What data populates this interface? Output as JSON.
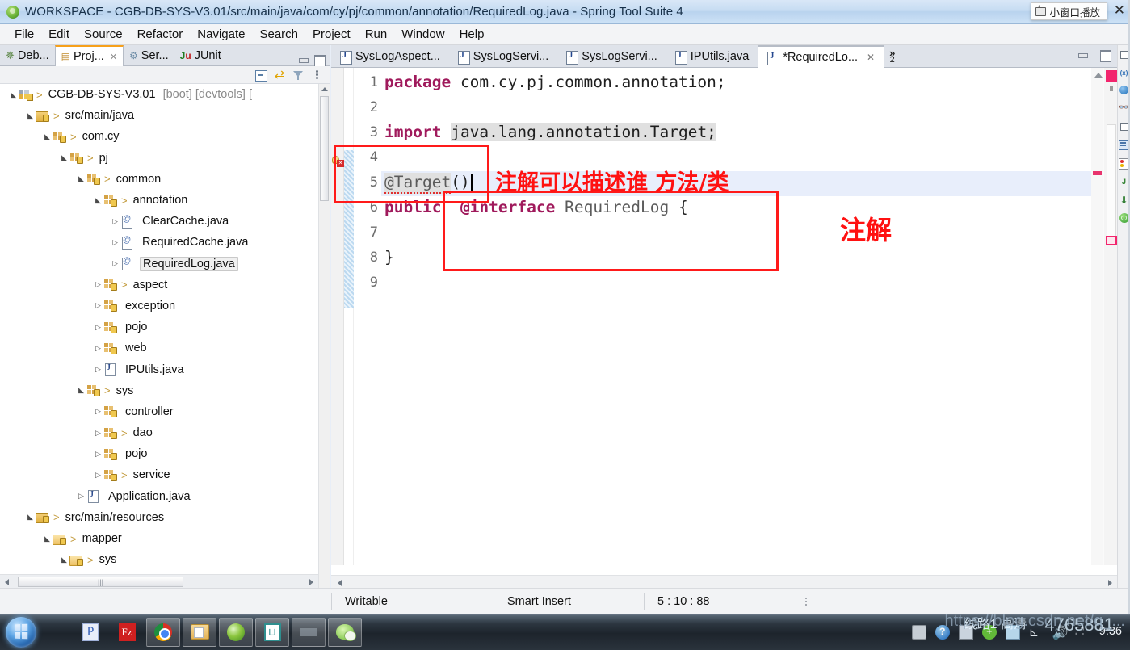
{
  "window": {
    "title": "WORKSPACE - CGB-DB-SYS-V3.01/src/main/java/com/cy/pj/common/annotation/RequiredLog.java - Spring Tool Suite 4",
    "app_icon": "sts-leaf-icon",
    "float_button_label": "小窗口播放",
    "close_label": "✕"
  },
  "menubar": {
    "items": [
      "File",
      "Edit",
      "Source",
      "Refactor",
      "Navigate",
      "Search",
      "Project",
      "Run",
      "Window",
      "Help"
    ]
  },
  "left_panel": {
    "tabs": [
      {
        "label": "Deb...",
        "icon": "debug-icon",
        "active": false,
        "closable": false
      },
      {
        "label": "Proj...",
        "icon": "package-explorer-icon",
        "active": true,
        "closable": true
      },
      {
        "label": "Ser...",
        "icon": "servers-icon",
        "active": false,
        "closable": false
      },
      {
        "label": "JUnit",
        "icon": "junit-icon",
        "active": false,
        "closable": false
      }
    ],
    "window_buttons": [
      "minimize-icon",
      "maximize-icon"
    ],
    "toolbar": [
      "collapse-all-icon",
      "link-with-editor-icon",
      "filter-icon",
      "view-menu-icon"
    ],
    "tree": [
      {
        "depth": 0,
        "expander": "expanded",
        "icon": "project-icon",
        "label": "CGB-DB-SYS-V3.01",
        "suffix": "[boot] [devtools] [",
        "arrow": true,
        "selected": false
      },
      {
        "depth": 1,
        "expander": "expanded",
        "icon": "source-folder-icon",
        "label": "src/main/java",
        "suffix": "",
        "arrow": true,
        "selected": false
      },
      {
        "depth": 2,
        "expander": "expanded",
        "icon": "package-icon",
        "label": "com.cy",
        "suffix": "",
        "arrow": true,
        "selected": false
      },
      {
        "depth": 3,
        "expander": "expanded",
        "icon": "package-icon",
        "label": "pj",
        "suffix": "",
        "arrow": true,
        "selected": false
      },
      {
        "depth": 4,
        "expander": "expanded",
        "icon": "package-icon",
        "label": "common",
        "suffix": "",
        "arrow": true,
        "selected": false
      },
      {
        "depth": 5,
        "expander": "expanded",
        "icon": "package-icon",
        "label": "annotation",
        "suffix": "",
        "arrow": true,
        "selected": false
      },
      {
        "depth": 6,
        "expander": "collapsed",
        "icon": "annotation-file-icon",
        "label": "ClearCache.java",
        "suffix": "",
        "arrow": false,
        "selected": false
      },
      {
        "depth": 6,
        "expander": "collapsed",
        "icon": "annotation-file-icon",
        "label": "RequiredCache.java",
        "suffix": "",
        "arrow": false,
        "selected": false
      },
      {
        "depth": 6,
        "expander": "collapsed",
        "icon": "annotation-file-icon",
        "label": "RequiredLog.java",
        "suffix": "",
        "arrow": false,
        "selected": true
      },
      {
        "depth": 5,
        "expander": "collapsed",
        "icon": "package-icon",
        "label": "aspect",
        "suffix": "",
        "arrow": true,
        "selected": false
      },
      {
        "depth": 5,
        "expander": "collapsed",
        "icon": "package-icon",
        "label": "exception",
        "suffix": "",
        "arrow": false,
        "selected": false
      },
      {
        "depth": 5,
        "expander": "collapsed",
        "icon": "package-icon",
        "label": "pojo",
        "suffix": "",
        "arrow": false,
        "selected": false
      },
      {
        "depth": 5,
        "expander": "collapsed",
        "icon": "package-icon",
        "label": "web",
        "suffix": "",
        "arrow": false,
        "selected": false
      },
      {
        "depth": 5,
        "expander": "collapsed",
        "icon": "java-file-icon",
        "label": "IPUtils.java",
        "suffix": "",
        "arrow": false,
        "selected": false
      },
      {
        "depth": 4,
        "expander": "expanded",
        "icon": "package-icon",
        "label": "sys",
        "suffix": "",
        "arrow": true,
        "selected": false
      },
      {
        "depth": 5,
        "expander": "collapsed",
        "icon": "package-icon",
        "label": "controller",
        "suffix": "",
        "arrow": false,
        "selected": false
      },
      {
        "depth": 5,
        "expander": "collapsed",
        "icon": "package-icon",
        "label": "dao",
        "suffix": "",
        "arrow": true,
        "selected": false
      },
      {
        "depth": 5,
        "expander": "collapsed",
        "icon": "package-icon",
        "label": "pojo",
        "suffix": "",
        "arrow": false,
        "selected": false
      },
      {
        "depth": 5,
        "expander": "collapsed",
        "icon": "package-icon",
        "label": "service",
        "suffix": "",
        "arrow": true,
        "selected": false
      },
      {
        "depth": 4,
        "expander": "collapsed",
        "icon": "java-file-icon",
        "label": "Application.java",
        "suffix": "",
        "arrow": false,
        "selected": false
      },
      {
        "depth": 1,
        "expander": "expanded",
        "icon": "source-folder-icon",
        "label": "src/main/resources",
        "suffix": "",
        "arrow": true,
        "selected": false
      },
      {
        "depth": 2,
        "expander": "expanded",
        "icon": "folder-icon",
        "label": "mapper",
        "suffix": "",
        "arrow": true,
        "selected": false
      },
      {
        "depth": 3,
        "expander": "expanded",
        "icon": "folder-icon",
        "label": "sys",
        "suffix": "",
        "arrow": true,
        "selected": false
      }
    ]
  },
  "editor": {
    "tabs": [
      {
        "label": "SysLogAspect...",
        "active": false,
        "dirty": false,
        "closable": false
      },
      {
        "label": "SysLogServi...",
        "active": false,
        "dirty": false,
        "closable": false
      },
      {
        "label": "SysLogServi...",
        "active": false,
        "dirty": false,
        "closable": false
      },
      {
        "label": "IPUtils.java",
        "active": false,
        "dirty": false,
        "closable": false
      },
      {
        "label": "*RequiredLo...",
        "active": true,
        "dirty": true,
        "closable": true
      }
    ],
    "overflow_label": "»",
    "overflow_count": "2",
    "window_buttons": [
      "minimize-icon",
      "maximize-icon"
    ],
    "line_numbers": [
      "1",
      "2",
      "3",
      "4",
      "5",
      "6",
      "7",
      "8",
      "9"
    ],
    "code_lines": [
      {
        "n": "1",
        "keyword": "package",
        "rest": " com.cy.pj.common.annotation;"
      },
      {
        "n": "2",
        "keyword": "",
        "rest": ""
      },
      {
        "n": "3",
        "keyword": "import",
        "rest": " java.lang.annotation.Target;"
      },
      {
        "n": "4",
        "keyword": "",
        "rest": ""
      },
      {
        "n": "5",
        "keyword": "",
        "rest": "@Target()"
      },
      {
        "n": "6",
        "keyword": "public",
        "rest": " @interface RequiredLog {"
      },
      {
        "n": "7",
        "keyword": "",
        "rest": ""
      },
      {
        "n": "8",
        "keyword": "",
        "rest": "}"
      },
      {
        "n": "9",
        "keyword": "",
        "rest": ""
      }
    ],
    "code_fragments": {
      "l1_kw": "package",
      "l1_rest": "com.cy.pj.common.annotation;",
      "l3_kw": "import",
      "l3_rest": "java.lang.annotation.Target;",
      "l5_at": "@Target",
      "l5_parens": "()",
      "l6_kw": "public",
      "l6_iface": "@interface",
      "l6_name": "RequiredLog",
      "l6_brace": "{",
      "l8_brace": "}"
    },
    "annotations": [
      {
        "text": "注解可以描述谁 方法/类",
        "color": "#ff1111"
      },
      {
        "text": "注解",
        "color": "#ff1111"
      }
    ],
    "marker": "error-warning-marker"
  },
  "status_bar": {
    "writable": "Writable",
    "insert_mode": "Smart Insert",
    "position": "5 : 10 : 88"
  },
  "taskbar": {
    "start_label": "start-orb",
    "items": [
      {
        "icon": "powerpoint-icon",
        "boxed": false
      },
      {
        "icon": "filezilla-icon",
        "boxed": false
      },
      {
        "icon": "chrome-icon",
        "boxed": true
      },
      {
        "icon": "explorer-icon",
        "boxed": true
      },
      {
        "icon": "sts-leaf-icon",
        "boxed": true
      },
      {
        "icon": "editplus-icon",
        "boxed": true
      },
      {
        "icon": "gray-app-icon",
        "boxed": true
      },
      {
        "icon": "wechat-icon",
        "boxed": true
      }
    ],
    "tray": [
      "keyboard-icon",
      "help-icon",
      "monitor-icon",
      "update-icon",
      "network-icon",
      "signal-icon",
      "volume-icon",
      "network2-icon"
    ],
    "clock": "9:36",
    "watermark": "https://blog.csdn.net/q_...",
    "player_overlay": "线路1 高清",
    "player_overlay2": "4765881"
  },
  "fast_view_bar": {
    "items": [
      "restore-icon",
      "variables-icon",
      "breakpoints-icon",
      "expressions-icon",
      "restore2-icon",
      "console-icon",
      "problems-icon",
      "junit-icon",
      "install-icon",
      "boot-dashboard-icon"
    ]
  },
  "colors": {
    "keyword": "#a01a5c",
    "annotation_red": "#ff1111",
    "tab_active_accent": "#f7a01a",
    "selection_bg": "#e8eefb",
    "highlight_bg": "#e0e0e0"
  }
}
